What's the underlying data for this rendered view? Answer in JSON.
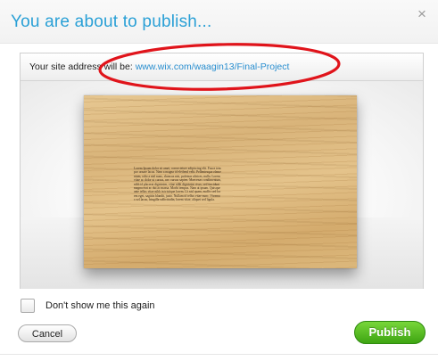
{
  "dialog": {
    "title": "You are about to publish...",
    "close_glyph": "×"
  },
  "address": {
    "label": "Your site address will be: ",
    "url": "www.wix.com/waagin13/Final-Project"
  },
  "preview": {
    "body_text": "Lorem Ipsum dolor sit amet, consectetuer adipiscing elit. Fusce tempor ornare lacus. Nam a magna id eleifend velit. Pellentesque elementum, odio a nisl nunc, rhoncus nisi, pulvinar ultrices, nulla. Lorem vitae ac dolor ut cursus, nec cursus sapien. Maecenas condimentum, nibh id placerat dignissim, vitae nibh dignissim risus, sed tincidunt magna erat ac dui ac massa. Morbi tempus. Nam at ipsum. Quisque ante tellus vitae nibh in tristique lorem. Ut nisl quam, mollis sed lorem eget, sagittis blandit, justo. Nullam id tellus vitae nunc. Vivamus vel lacus, fringilla sollicitudin, lorem vitae, aliquet sed ligula."
  },
  "options": {
    "dont_show_label": "Don't show me this again",
    "dont_show_checked": false
  },
  "buttons": {
    "cancel_label": "Cancel",
    "publish_label": "Publish"
  },
  "colors": {
    "title": "#2aa0d6",
    "link": "#2a8fd0",
    "publish": "#4cb81f",
    "annotation": "#e0141b"
  }
}
